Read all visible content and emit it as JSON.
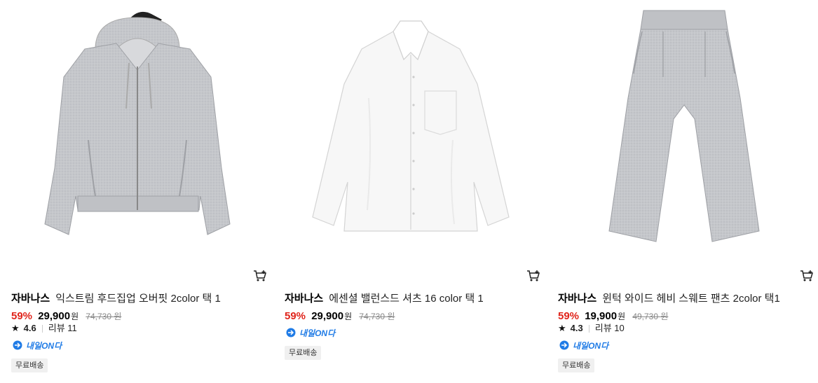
{
  "products": [
    {
      "image_icon": "hoodie-zipup-image",
      "brand": "자바나스",
      "name": "익스트림 후드집업 오버핏 2color 택 1",
      "discount": "59%",
      "price": "29,900",
      "currency": "원",
      "original_price": "74,730",
      "rating": "4.6",
      "review_label": "리뷰 11",
      "delivery_badge": "내일ON다",
      "shipping": "무료배송",
      "has_rating": true
    },
    {
      "image_icon": "white-shirt-image",
      "brand": "자바나스",
      "name": "에센셜 밸런스드 셔츠 16 color 택 1",
      "discount": "59%",
      "price": "29,900",
      "currency": "원",
      "original_price": "74,730",
      "delivery_badge": "내일ON다",
      "shipping": "무료배송",
      "has_rating": false
    },
    {
      "image_icon": "sweat-pants-image",
      "brand": "자바나스",
      "name": "윈턱 와이드 헤비 스웨트 팬츠 2color 택1",
      "discount": "59%",
      "price": "19,900",
      "currency": "원",
      "original_price": "49,730",
      "rating": "4.3",
      "review_label": "리뷰 10",
      "delivery_badge": "내일ON다",
      "shipping": "무료배송",
      "has_rating": true
    }
  ],
  "colors": {
    "discount": "#e0241b",
    "badge": "#1f7be6",
    "garment_gray": "#c4c6ca",
    "garment_white": "#f7f7f7"
  }
}
